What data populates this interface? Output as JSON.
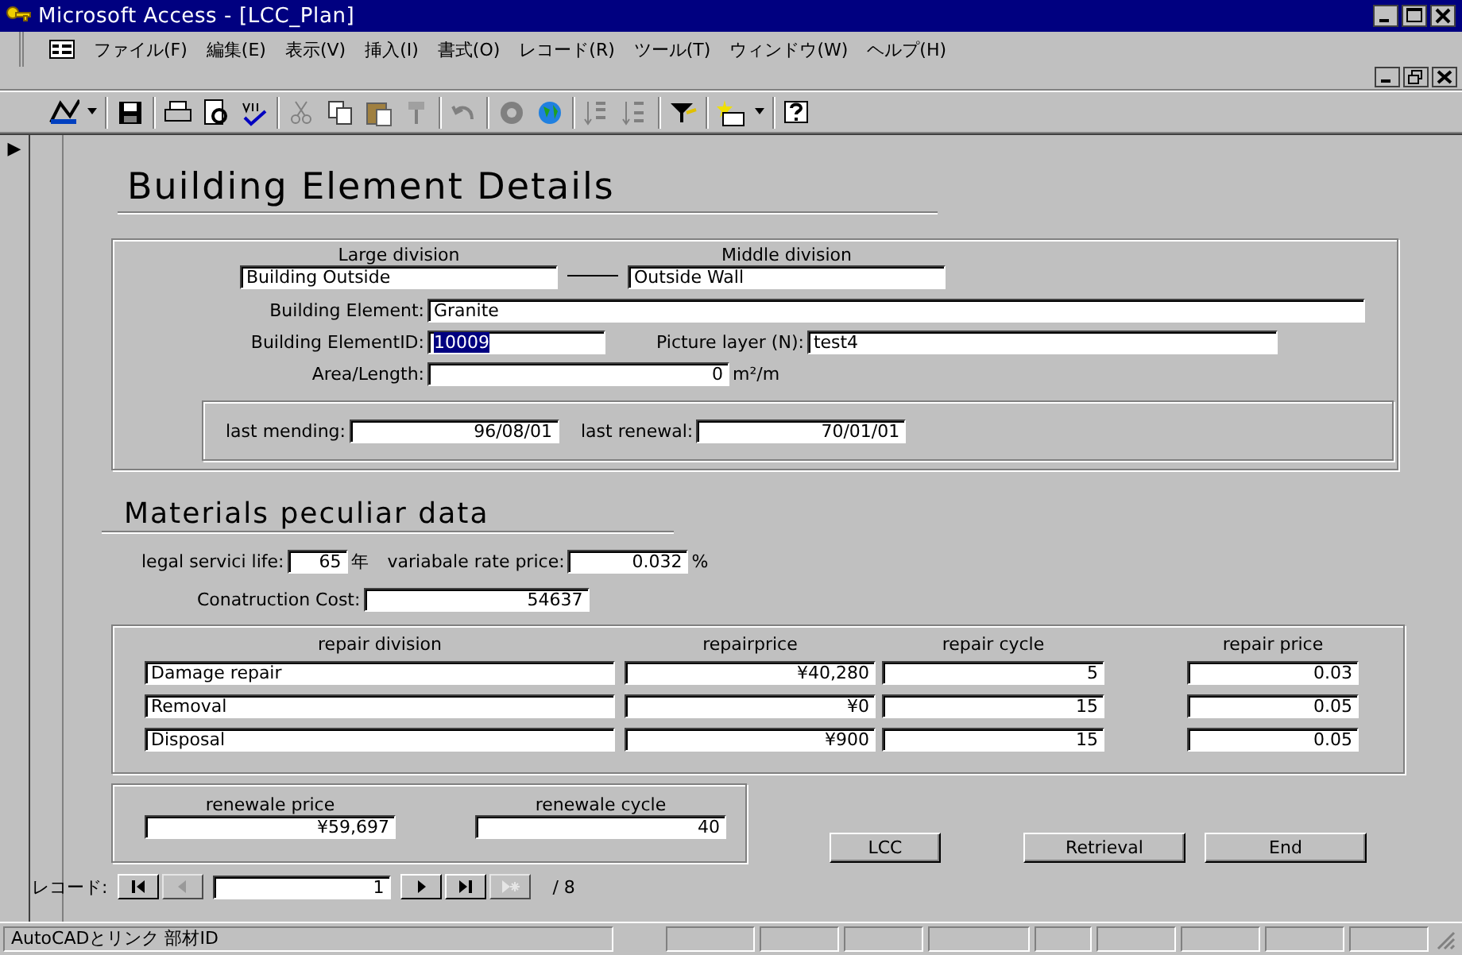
{
  "window": {
    "title": "Microsoft Access - [LCC_Plan]"
  },
  "menu": [
    "ファイル(F)",
    "編集(E)",
    "表示(V)",
    "挿入(I)",
    "書式(O)",
    "レコード(R)",
    "ツール(T)",
    "ウィンドウ(W)",
    "ヘルプ(H)"
  ],
  "record_marker": "▶",
  "form": {
    "title": "Building Element Details",
    "large_division": {
      "label": "Large division",
      "value": "Building Outside"
    },
    "middle_division": {
      "label": "Middle  division",
      "value": "Outside Wall"
    },
    "building_element": {
      "label": "Building Element:",
      "value": "Granite"
    },
    "building_element_id": {
      "label": "Building ElementID:",
      "value": "10009",
      "text_selected": true
    },
    "picture_layer": {
      "label": "Picture layer (N):",
      "value": "test4"
    },
    "area_length": {
      "label": "Area/Length:",
      "value": "0",
      "unit": "m²/m"
    },
    "last_mending": {
      "label": "last mending:",
      "value": "96/08/01"
    },
    "last_renewal": {
      "label": "last renewal:",
      "value": "70/01/01"
    },
    "materials_title": "Materials peculiar data",
    "legal_life": {
      "label": "legal servici life:",
      "value": "65",
      "unit": "年"
    },
    "variable_rate": {
      "label": "variabale rate price:",
      "value": "0.032",
      "unit": "%"
    },
    "construction_cost": {
      "label": "Conatruction Cost:",
      "value": "54637"
    },
    "repair_columns": [
      "repair division",
      "repairprice",
      "repair cycle",
      "repair price"
    ],
    "repair_rows": [
      {
        "division": "Damage repair",
        "price": "¥40,280",
        "cycle": "5",
        "rate": "0.03"
      },
      {
        "division": "Removal",
        "price": "¥0",
        "cycle": "15",
        "rate": "0.05"
      },
      {
        "division": "Disposal",
        "price": "¥900",
        "cycle": "15",
        "rate": "0.05"
      }
    ],
    "renewal_price": {
      "label": "renewale price",
      "value": "¥59,697"
    },
    "renewal_cycle": {
      "label": "renewale cycle",
      "value": "40"
    },
    "buttons": [
      "LCC",
      "Retrieval",
      "End"
    ]
  },
  "record_nav": {
    "label": "レコード:",
    "current": "1",
    "total": "/ 8"
  },
  "status_bar": {
    "text": "AutoCADとリンク  部材ID"
  }
}
